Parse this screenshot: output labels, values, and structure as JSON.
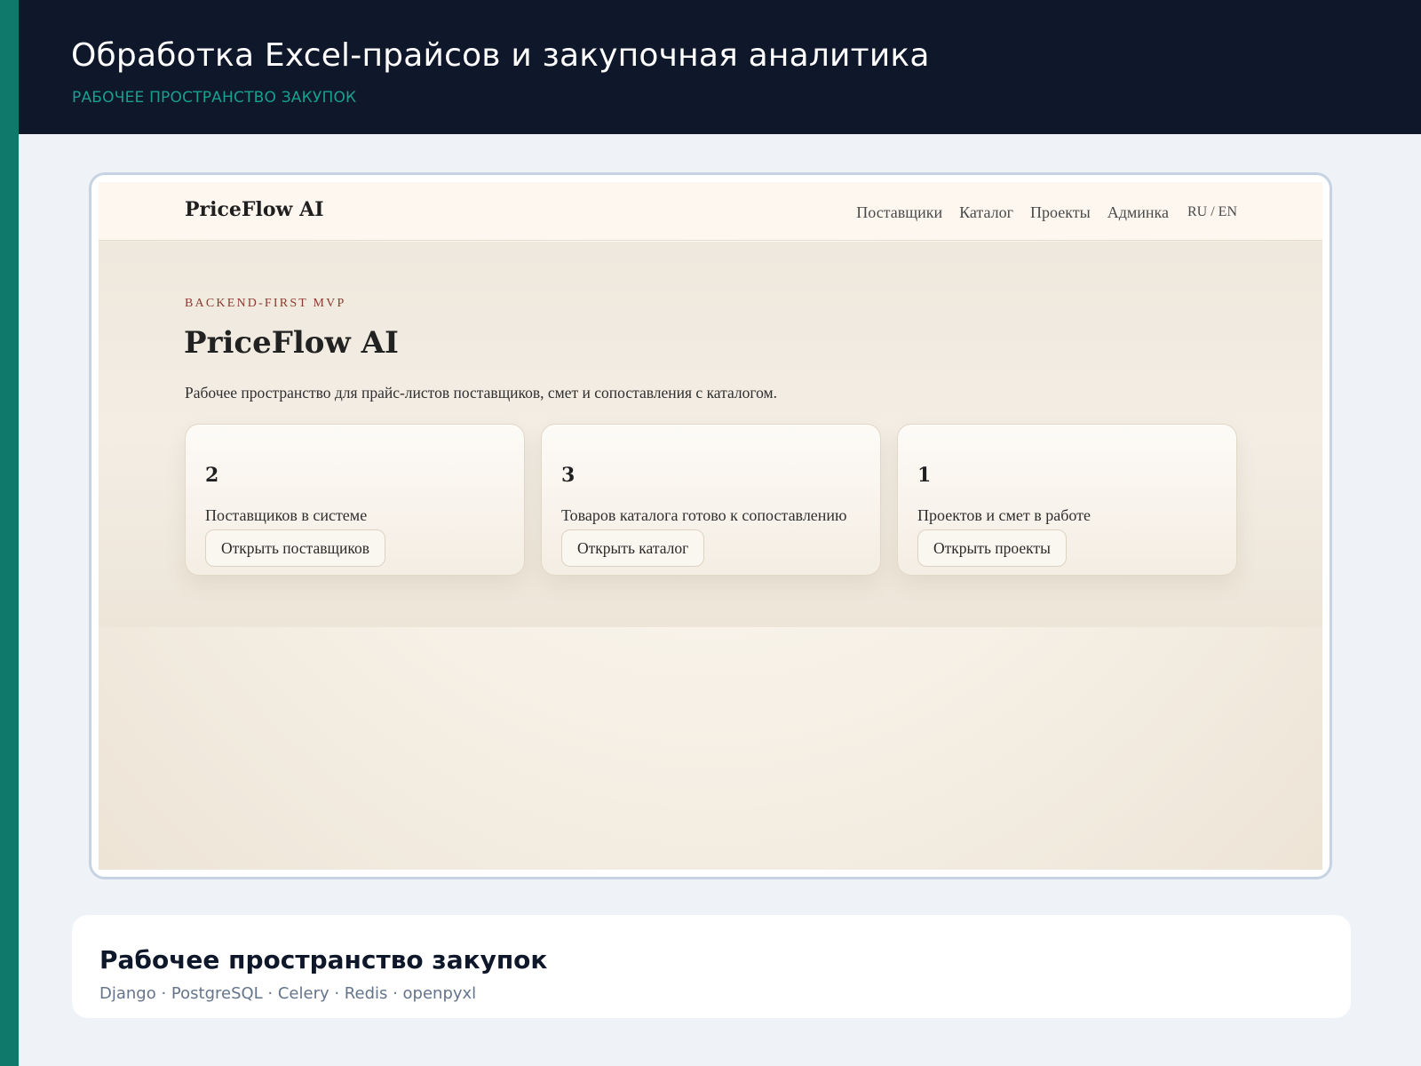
{
  "header": {
    "title": "Обработка Excel-прайсов и закупочная аналитика",
    "subtitle": "РАБОЧЕЕ ПРОСТРАНСТВО ЗАКУПОК"
  },
  "preview": {
    "brand": "PriceFlow AI",
    "nav": {
      "items": [
        "Поставщики",
        "Каталог",
        "Проекты",
        "Админка"
      ],
      "lang": "RU / EN"
    },
    "hero": {
      "kicker": "BACKEND-FIRST MVP",
      "title": "PriceFlow AI",
      "description": "Рабочее пространство для прайс-листов поставщиков, смет и сопоставления с каталогом."
    },
    "cards": [
      {
        "value": "2",
        "label": "Поставщиков в системе",
        "button": "Открыть поставщиков"
      },
      {
        "value": "3",
        "label": "Товаров каталога готово к сопоставлению",
        "button": "Открыть каталог"
      },
      {
        "value": "1",
        "label": "Проектов и смет в работе",
        "button": "Открыть проекты"
      }
    ]
  },
  "footer_card": {
    "title": "Рабочее пространство закупок",
    "stack": "Django · PostgreSQL · Celery · Redis · openpyxl"
  },
  "colors": {
    "accent": "#0f7a6c",
    "header_bg": "#0f172a",
    "subtitle": "#17a08f",
    "kicker": "#8b3a2f"
  }
}
